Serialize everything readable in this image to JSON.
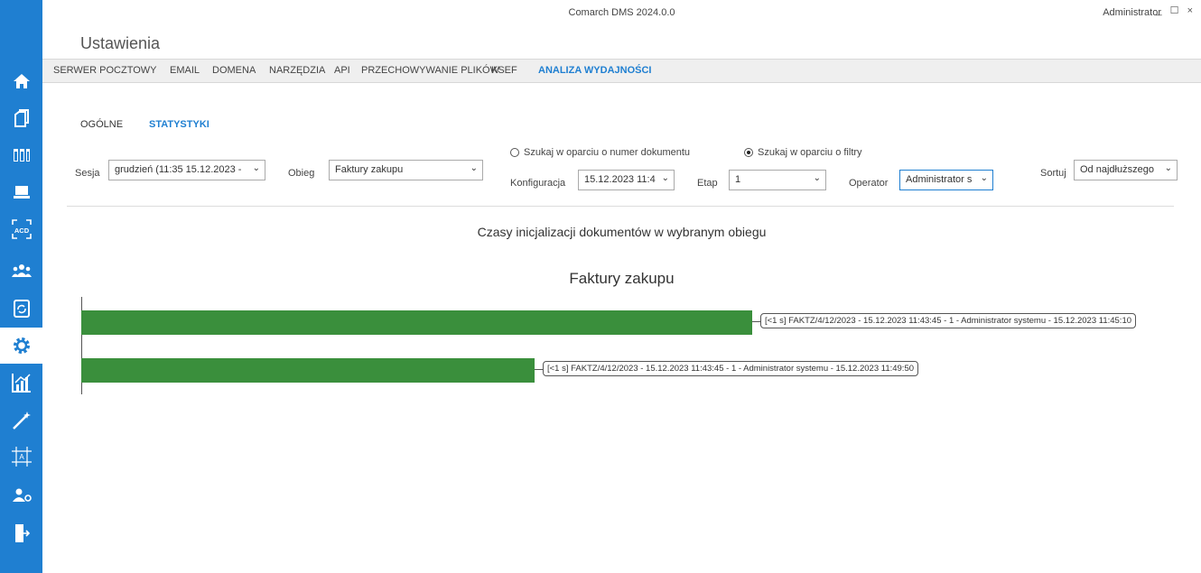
{
  "window": {
    "app_title": "Comarch DMS 2024.0.0",
    "user": "Administrator",
    "controls": "_ ☐ ×"
  },
  "page": {
    "title": "Ustawienia"
  },
  "menu": {
    "items": [
      {
        "label": "SERWER POCZTOWY",
        "active": false
      },
      {
        "label": "EMAIL",
        "active": false
      },
      {
        "label": "DOMENA",
        "active": false
      },
      {
        "label": "NARZĘDZIA",
        "active": false
      },
      {
        "label": "API",
        "active": false
      },
      {
        "label": "PRZECHOWYWANIE PLIKÓW",
        "active": false
      },
      {
        "label": "KSEF",
        "active": false
      },
      {
        "label": "ANALIZA WYDAJNOŚCI",
        "active": true
      }
    ]
  },
  "subtabs": [
    {
      "label": "OGÓLNE",
      "active": false
    },
    {
      "label": "STATYSTYKI",
      "active": true
    }
  ],
  "filters": {
    "sesja_label": "Sesja",
    "sesja_value": "grudzień (11:35 15.12.2023 -",
    "obieg_label": "Obieg",
    "obieg_value": "Faktury zakupu",
    "radio_number": "Szukaj w oparciu o numer dokumentu",
    "radio_filters": "Szukaj w oparciu o filtry",
    "konfiguracja_label": "Konfiguracja",
    "konfiguracja_value": "15.12.2023 11:4",
    "etap_label": "Etap",
    "etap_value": "1",
    "operator_label": "Operator",
    "operator_value": "Administrator s",
    "sortuj_label": "Sortuj",
    "sortuj_value": "Od najdłuższego"
  },
  "sidebar": {
    "icons": [
      "home-icon",
      "documents-icon",
      "columns-icon",
      "computer-icon",
      "ocr-acd-icon",
      "users-group-icon",
      "document-refresh-icon",
      "gear-icon",
      "statistics-icon",
      "magic-wand-icon",
      "template-designer-icon",
      "user-settings-icon",
      "exit-icon"
    ],
    "active_icon": "gear-icon"
  },
  "chart_data": {
    "type": "bar",
    "orientation": "horizontal",
    "title": "Czasy inicjalizacji dokumentów w wybranym obiegu",
    "subtitle": "Faktury zakupu",
    "bar_color": "#3a8f3c",
    "categories": [
      "[<1 s] FAKTZ/4/12/2023 - 15.12.2023 11:43:45 - 1 - Administrator systemu - 15.12.2023 11:45:10",
      "[<1 s] FAKTZ/4/12/2023 - 15.12.2023 11:43:45 - 1 - Administrator systemu - 15.12.2023 11:49:50"
    ],
    "values": [
      1.0,
      0.675
    ],
    "xlim": [
      0,
      1
    ],
    "grid": false
  },
  "colors": {
    "accent": "#1f7fd1",
    "bar": "#3a8f3c"
  }
}
